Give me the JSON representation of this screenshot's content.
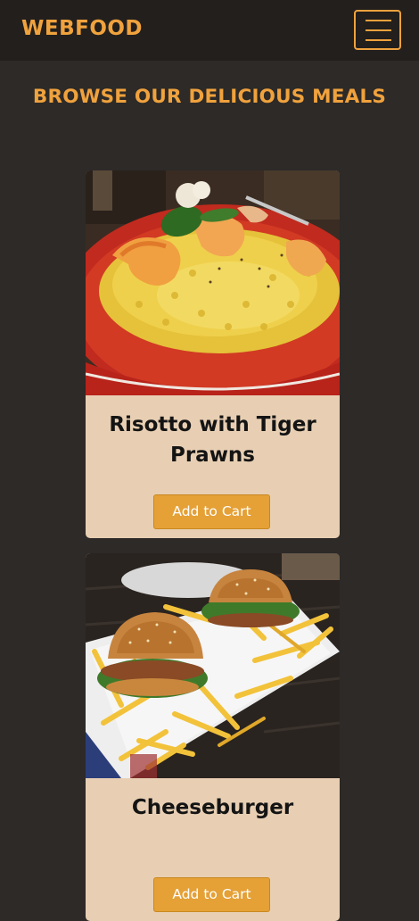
{
  "navbar": {
    "brand": "WEBFOOD",
    "menu_icon": "hamburger-menu-icon"
  },
  "page": {
    "heading": "BROWSE OUR DELICIOUS MEALS"
  },
  "meals": [
    {
      "title": "Risotto with Tiger Prawns",
      "image": "risotto-tiger-prawns-photo",
      "button_label": "Add to Cart"
    },
    {
      "title": "Cheeseburger",
      "image": "burgers-with-fries-photo",
      "button_label": "Add to Cart"
    }
  ],
  "colors": {
    "background": "#2d2a28",
    "navbar": "#221f1d",
    "accent": "#f0a23d",
    "card": "#e8cfb3",
    "button": "#e5a036"
  }
}
